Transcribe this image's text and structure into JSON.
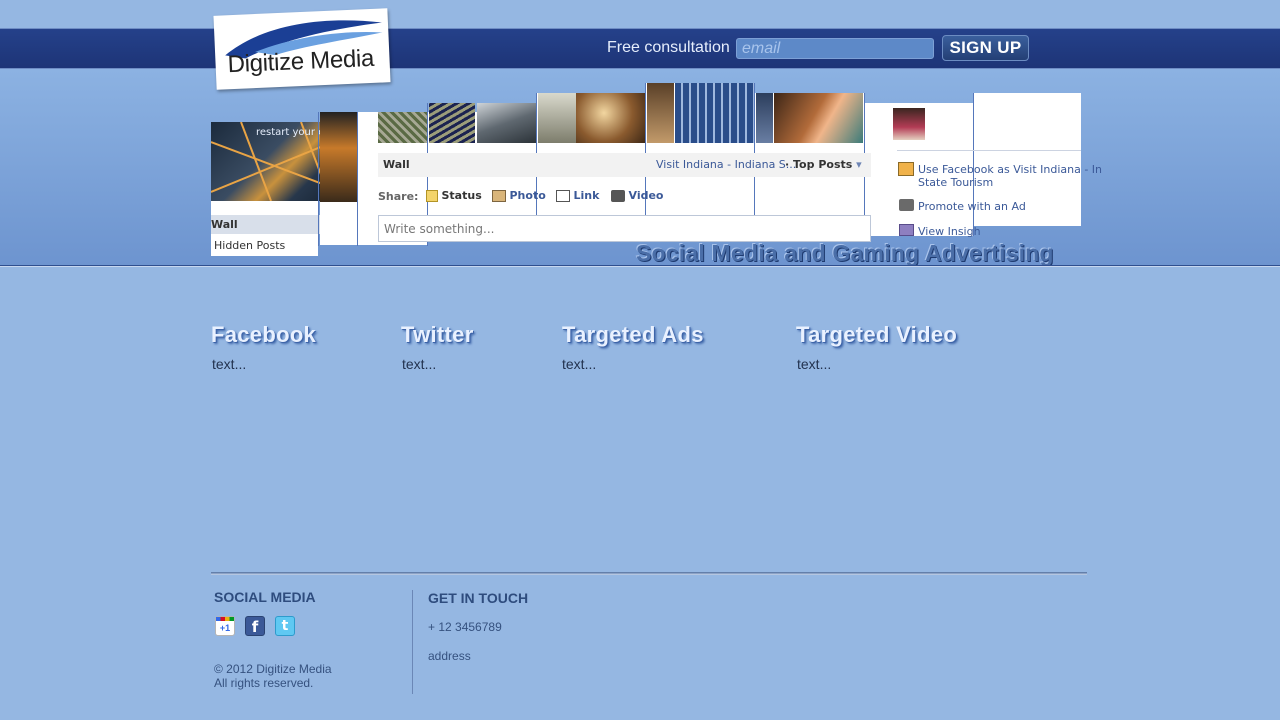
{
  "header": {
    "logo_text": "Digitize Media",
    "free_label": "Free consultation",
    "email_placeholder": "email",
    "signup_label": "SIGN UP"
  },
  "hero": {
    "tagline": "Social Media and Gaming Advertising",
    "photo_overlay_text": "restart your engines",
    "fb": {
      "wall_label": "Wall",
      "hidden_posts": "Hidden Posts",
      "wall_heading": "Wall",
      "page_name": "Visit Indiana - Indiana S...",
      "top_posts": "Top Posts",
      "share_label": "Share:",
      "status": "Status",
      "photo": "Photo",
      "link": "Link",
      "video": "Video",
      "composer_placeholder": "Write something...",
      "use_facebook_as": "Use Facebook as Visit Indiana - In",
      "state_tourism": "State Tourism",
      "promote": "Promote with an Ad",
      "insights": "View Insigh"
    }
  },
  "columns": [
    {
      "title": "Facebook",
      "text": "text..."
    },
    {
      "title": "Twitter",
      "text": "text..."
    },
    {
      "title": "Targeted Ads",
      "text": "text..."
    },
    {
      "title": "Targeted Video",
      "text": "text..."
    }
  ],
  "footer": {
    "social_heading": "SOCIAL MEDIA",
    "copyright_line1": "© 2012 Digitize Media",
    "copyright_line2": "All rights reserved.",
    "contact_heading": "GET IN TOUCH",
    "phone": "+ 12 3456789",
    "address": "address",
    "icons": [
      "google-plus-icon",
      "facebook-icon",
      "twitter-icon"
    ],
    "google_label": "+1",
    "facebook_label": "f",
    "twitter_label": "t"
  },
  "colors": {
    "background": "#95b7e2",
    "topbar": "#1f3779",
    "accent": "#3b5998"
  }
}
